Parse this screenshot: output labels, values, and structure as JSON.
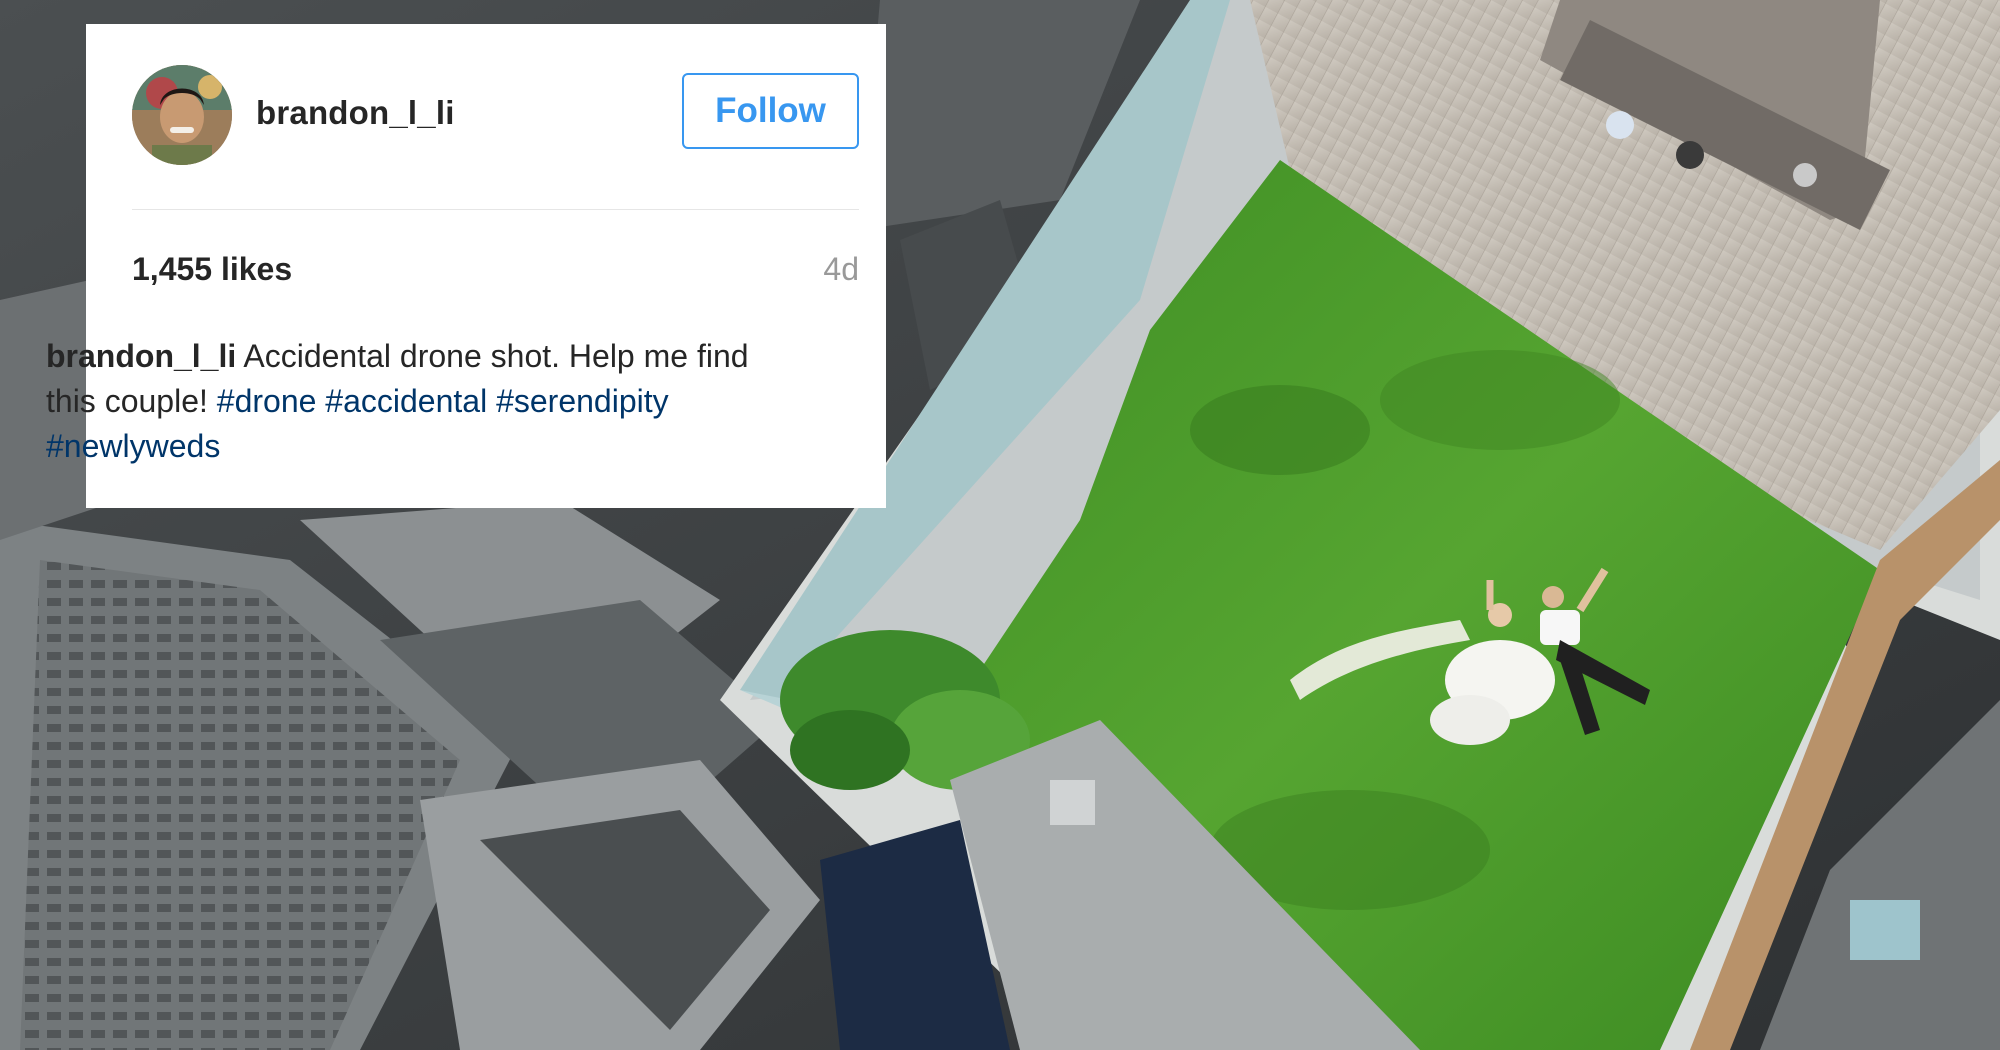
{
  "post": {
    "username": "brandon_l_li",
    "follow_label": "Follow",
    "likes": "1,455 likes",
    "age": "4d",
    "caption_user": "brandon_l_li",
    "caption_text": "Accidental drone shot. Help me find this couple!",
    "hashtags": [
      "#drone",
      "#accidental",
      "#serendipity",
      "#newlyweds"
    ]
  },
  "colors": {
    "follow_blue": "#3897f0",
    "hashtag_blue": "#003569",
    "muted_gray": "#999999",
    "grass_green": "#4a9a2a"
  },
  "icons": {
    "avatar": "profile-photo"
  }
}
